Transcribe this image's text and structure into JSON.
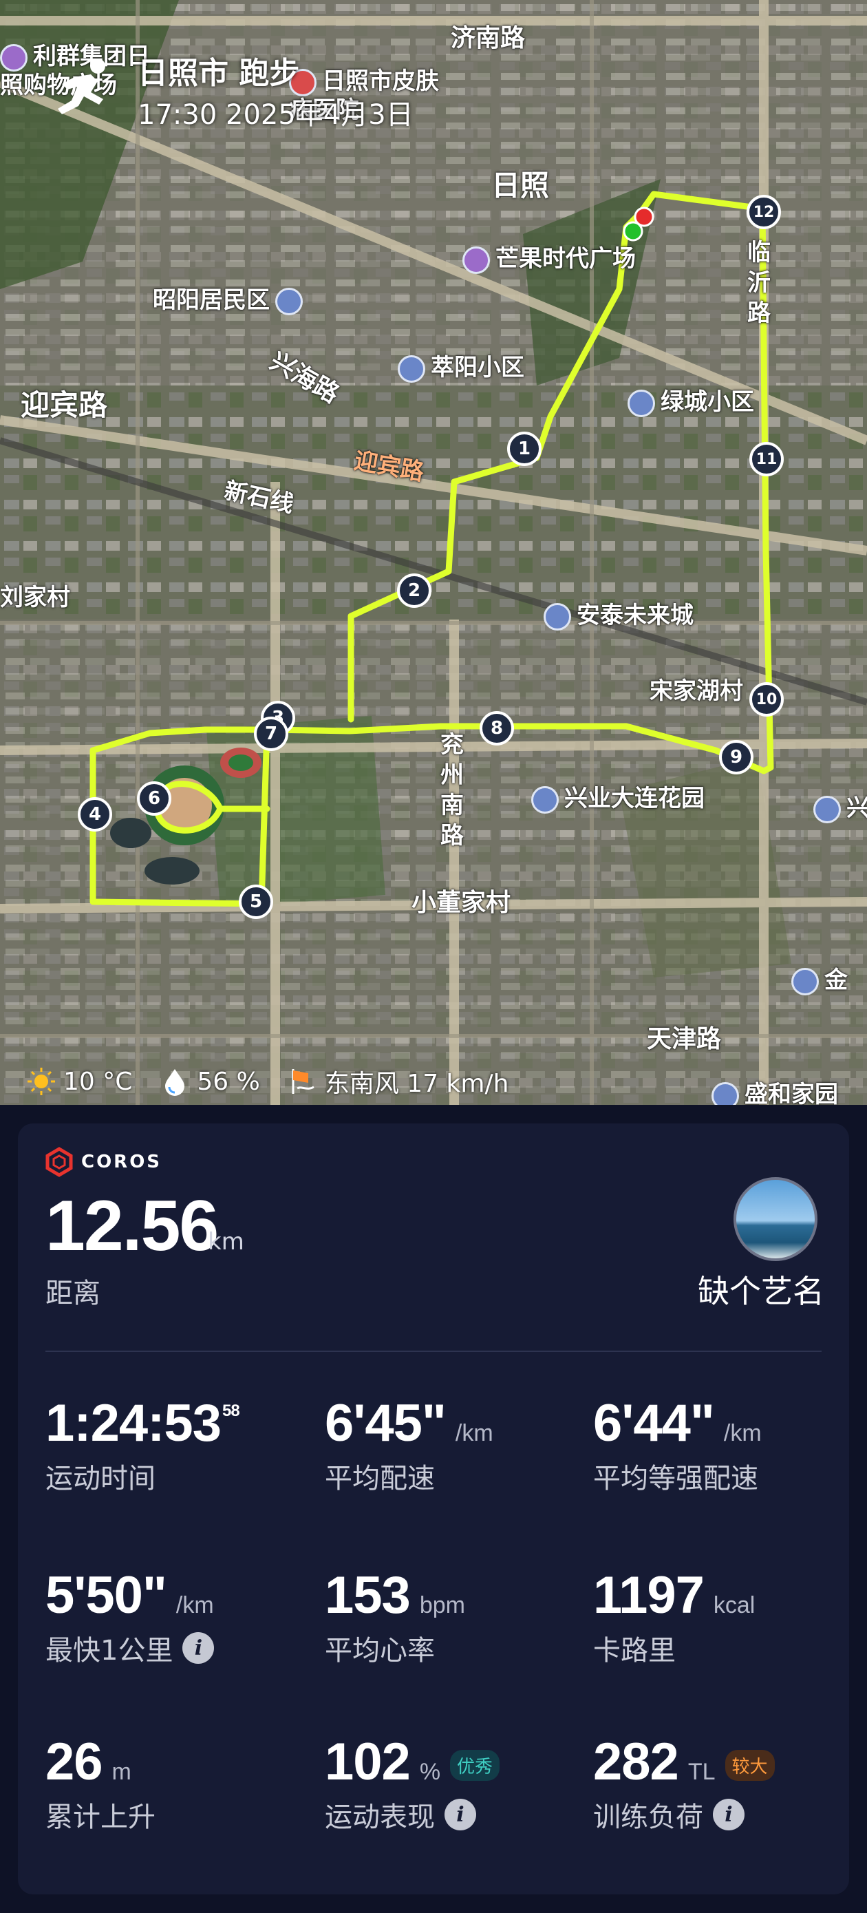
{
  "header": {
    "title": "日照市 跑步",
    "datetime": "17:30 2025年4月3日"
  },
  "map": {
    "road_labels": [
      "济南路",
      "兴海路",
      "迎宾路",
      "迎宾路",
      "新石线",
      "临沂路",
      "兖州南路",
      "天津路"
    ],
    "place_labels": [
      "利群集团日照购物广场",
      "日照市皮肤病医院",
      "日照",
      "芒果时代广场",
      "昭阳居民区",
      "萃阳小区",
      "绿城小区",
      "刘家村",
      "安泰未来城",
      "宋家湖村",
      "兴业大连花园",
      "小董家村",
      "金",
      "盛和家园",
      "兴"
    ],
    "markers": [
      "1",
      "2",
      "3",
      "4",
      "5",
      "6",
      "7",
      "8",
      "9",
      "10",
      "11",
      "12"
    ],
    "route_color": "#dfff2c",
    "start_color": "#22c02a",
    "end_color": "#e52b2b"
  },
  "weather": {
    "temperature": "10 °C",
    "humidity": "56 %",
    "wind": "东南风 17 km/h",
    "icons": [
      "sun-icon",
      "water-drop-icon",
      "wind-flag-icon"
    ]
  },
  "card": {
    "brand": "COROS",
    "distance": {
      "value": "12.56",
      "unit": "km",
      "label": "距离"
    },
    "user": {
      "name": "缺个艺名"
    },
    "stats": [
      {
        "value": "1:24:53",
        "sup": "58",
        "unit": "",
        "label": "运动时间"
      },
      {
        "value": "6'45\"",
        "unit": "/km",
        "label": "平均配速"
      },
      {
        "value": "6'44\"",
        "unit": "/km",
        "label": "平均等强配速"
      },
      {
        "value": "5'50\"",
        "unit": "/km",
        "label": "最快1公里"
      },
      {
        "value": "153",
        "unit": "bpm",
        "label": "平均心率"
      },
      {
        "value": "1197",
        "unit": "kcal",
        "label": "卡路里"
      },
      {
        "value": "26",
        "unit": "m",
        "label": "累计上升"
      },
      {
        "value": "102",
        "unit": "%",
        "badge": "优秀",
        "label": "运动表现"
      },
      {
        "value": "282",
        "unit": "TL",
        "badge": "较大",
        "label": "训练负荷"
      }
    ]
  }
}
